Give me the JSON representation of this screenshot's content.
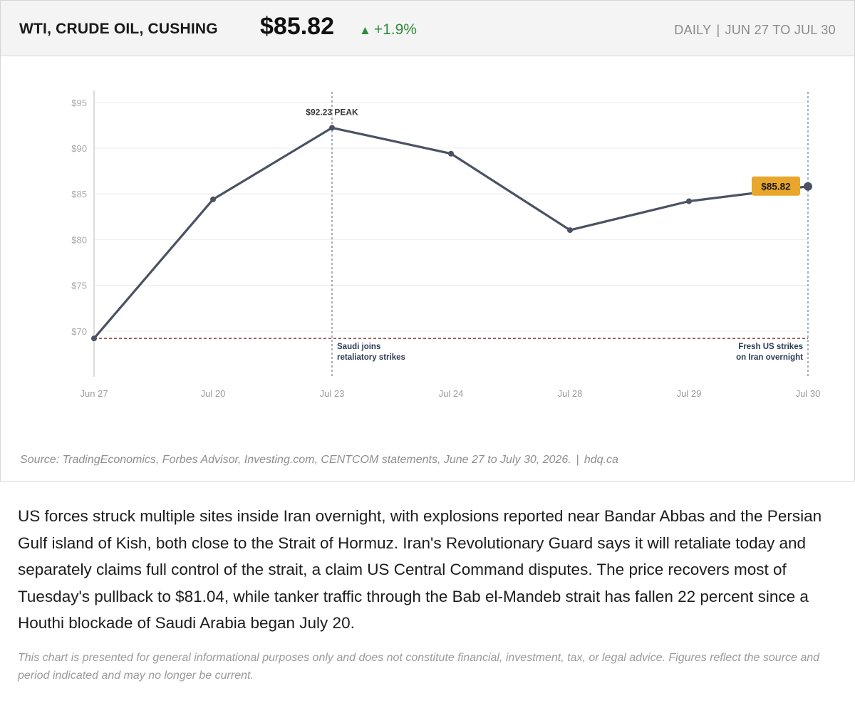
{
  "header": {
    "title": "WTI, CRUDE OIL, CUSHING",
    "price": "$85.82",
    "change_arrow": "▲",
    "change": "+1.9%",
    "frequency": "DAILY",
    "separator": "|",
    "range": "JUN 27 TO JUL 30"
  },
  "colors": {
    "line": "#4a5263",
    "accent_badge": "#e8a62a",
    "up": "#2e8b3a",
    "baseline": "#8b3a3a",
    "event_line": "#6f86a8",
    "grid": "#ececec"
  },
  "chart_data": {
    "type": "line",
    "x": [
      "Jun 27",
      "Jul 20",
      "Jul 23",
      "Jul 24",
      "Jul 28",
      "Jul 29",
      "Jul 30"
    ],
    "series": [
      {
        "values": [
          69.2,
          84.4,
          92.23,
          89.4,
          81.04,
          84.2,
          85.82
        ]
      }
    ],
    "yticks": [
      "$95",
      "$90",
      "$85",
      "$80",
      "$75",
      "$70"
    ],
    "ytick_values": [
      95,
      90,
      85,
      80,
      75,
      70
    ],
    "ylim": [
      65,
      96
    ],
    "grid": true,
    "reference_line": {
      "value": 69.2,
      "style": "dashed"
    },
    "peak_label": "$92.23 PEAK",
    "last_label": "$85.82",
    "events": [
      {
        "x": "Jul 23",
        "lines": [
          "Saudi joins",
          "retaliatory strikes"
        ],
        "align": "left"
      },
      {
        "x": "Jul 30",
        "lines": [
          "Fresh US strikes",
          "on Iran overnight"
        ],
        "align": "right"
      }
    ]
  },
  "source": {
    "text": "Source: TradingEconomics, Forbes Advisor, Investing.com, CENTCOM statements, June 27 to July 30, 2026.",
    "separator": "|",
    "site": "hdq.ca"
  },
  "article": {
    "body": "US forces struck multiple sites inside Iran overnight, with explosions reported near Bandar Abbas and the Persian Gulf island of Kish, both close to the Strait of Hormuz. Iran's Revolutionary Guard says it will retaliate today and separately claims full control of the strait, a claim US Central Command disputes. The price recovers most of Tuesday's pullback to $81.04, while tanker traffic through the Bab el-Mandeb strait has fallen 22 percent since a Houthi blockade of Saudi Arabia began July 20.",
    "disclaimer": "This chart is presented for general informational purposes only and does not constitute financial, investment, tax, or legal advice. Figures reflect the source and period indicated and may no longer be current."
  }
}
